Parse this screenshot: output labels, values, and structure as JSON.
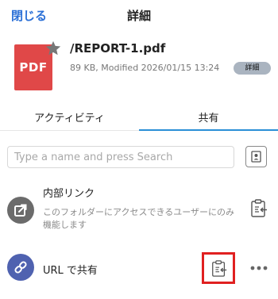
{
  "header": {
    "close_label": "閉じる",
    "title": "詳細"
  },
  "file": {
    "type_label": "PDF",
    "name": "/REPORT-1.pdf",
    "meta": "89 KB, Modified 2026/01/15 13:24",
    "details_label": "詳細",
    "thumb_color": "#e04848"
  },
  "tabs": [
    {
      "label": "アクティビティ",
      "active": false
    },
    {
      "label": "共有",
      "active": true
    }
  ],
  "search": {
    "placeholder": "Type a name and press Search",
    "value": ""
  },
  "internal_link": {
    "title": "内部リンク",
    "description": "このフォルダーにアクセスできるユーザーにのみ機能します",
    "icon_color": "#6b6b6b"
  },
  "url_share": {
    "label": "URL で共有",
    "icon_color": "#4f62b0",
    "highlight_color": "#e02020"
  },
  "colors": {
    "accent": "#2a6fd6",
    "tab_active": "#2a8fd6"
  }
}
